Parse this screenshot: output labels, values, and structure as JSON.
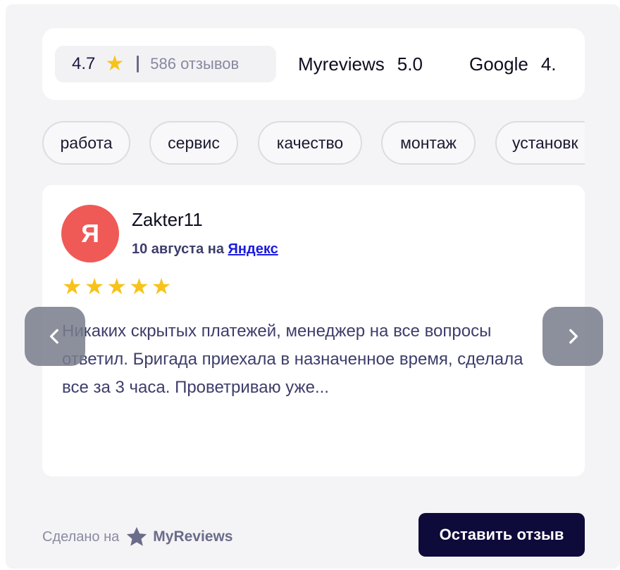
{
  "ratings": {
    "summary": {
      "rating": "4.7",
      "star": "★",
      "count": "586 отзывов"
    },
    "sources": [
      {
        "name": "Myreviews",
        "value": "5.0"
      },
      {
        "name": "Google",
        "value": "4."
      }
    ]
  },
  "tags": [
    "работа",
    "сервис",
    "качество",
    "монтаж",
    "установк"
  ],
  "review": {
    "avatar_letter": "Я",
    "author": "Zakter11",
    "date_prefix": "10 августа на ",
    "source_link": "Яндекс",
    "stars": "★★★★★",
    "rating_value": 5,
    "text": "Никаких скрытых платежей, менеджер на все вопросы ответил. Бригада приехала в назначенное время, сделала все за 3 часа. Проветриваю уже..."
  },
  "footer": {
    "made_on": "Сделано на",
    "brand": "MyReviews",
    "leave_button": "Оставить отзыв"
  },
  "colors": {
    "star": "#f7c31b",
    "avatar": "#ef5a56",
    "button": "#0e0a3a",
    "link": "#1a1ae0"
  },
  "icons": {
    "prev": "chevron-left-icon",
    "next": "chevron-right-icon",
    "brand": "star-logo-icon"
  }
}
